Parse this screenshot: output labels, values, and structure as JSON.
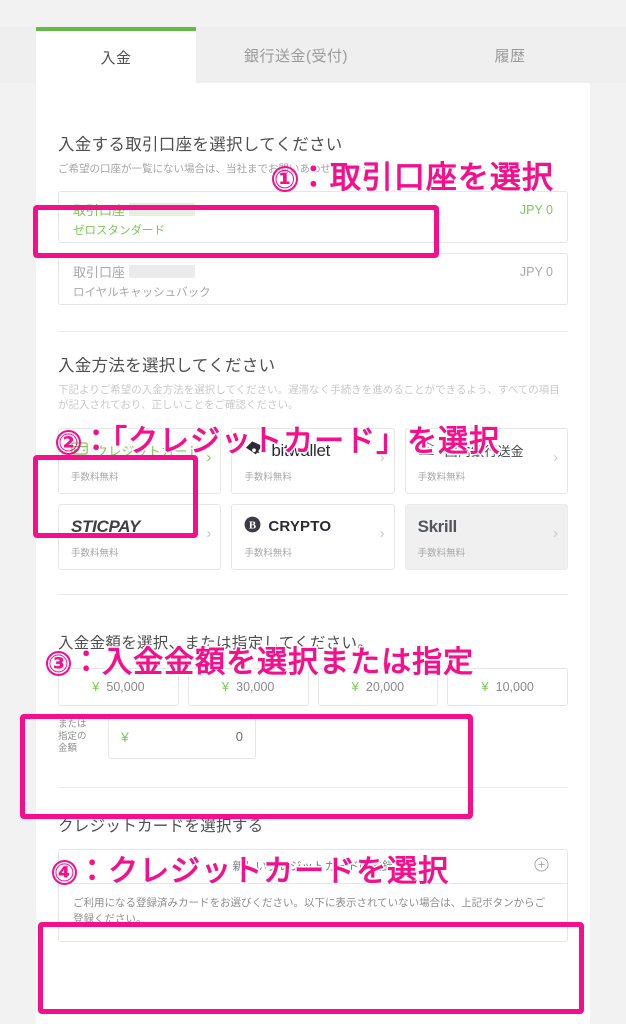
{
  "tabs": [
    {
      "label": "入金",
      "active": true
    },
    {
      "label": "銀行送金(受付)",
      "active": false
    },
    {
      "label": "履歴",
      "active": false
    }
  ],
  "account_section": {
    "title": "入金する取引口座を選択してください",
    "subtitle": "ご希望の口座が一覧にない場合は、当社までお問いあわせください。",
    "accounts": [
      {
        "label": "取引口座",
        "type": "ゼロスタンダード",
        "amount": "JPY 0",
        "selected": true
      },
      {
        "label": "取引口座",
        "type": "ロイヤルキャッシュバック",
        "amount": "JPY 0",
        "selected": false
      }
    ]
  },
  "method_section": {
    "title": "入金方法を選択してください",
    "subtitle": "下記よりご希望の入金方法を選択してください。遅滞なく手続きを進めることができるよう、すべての項目が記入されており、正しいことをご確認ください。",
    "methods": [
      {
        "name": "クレジットカード",
        "fee": "手数料無料",
        "icon": "credit-card-icon",
        "selected": true,
        "grey": false
      },
      {
        "name": "bitwallet",
        "fee": "手数料無料",
        "icon": "bitwallet-logo",
        "selected": false,
        "grey": false
      },
      {
        "name": "国内銀行送金",
        "fee": "手数料無料",
        "icon": "bank-icon",
        "selected": false,
        "grey": false
      },
      {
        "name": "STICPAY",
        "fee": "手数料無料",
        "icon": "sticpay-logo",
        "selected": false,
        "grey": false
      },
      {
        "name": "CRYPTO",
        "fee": "手数料無料",
        "icon": "bitcoin-icon",
        "selected": false,
        "grey": false
      },
      {
        "name": "Skrill",
        "fee": "手数料無料",
        "icon": "skrill-logo",
        "selected": false,
        "grey": true
      }
    ]
  },
  "amount_section": {
    "title": "入金金額を選択、または指定してください。",
    "presets": [
      {
        "yen": "¥",
        "value": "50,000"
      },
      {
        "yen": "¥",
        "value": "30,000"
      },
      {
        "yen": "¥",
        "value": "20,000"
      },
      {
        "yen": "¥",
        "value": "10,000"
      }
    ],
    "custom_label": "または\n指定の\n金額",
    "custom_label_lines": [
      "または",
      "指定の",
      "金額"
    ],
    "custom_yen": "¥",
    "custom_value": "0"
  },
  "card_section": {
    "title": "クレジットカードを選択する",
    "register_label": "新しいクレジットカードの登録",
    "plus_icon": "plus-circle-icon",
    "note": "ご利用になる登録済みカードをお選びください。以下に表示されていない場合は、上記ボタンからご登録ください。"
  },
  "annotations": [
    {
      "num": "①",
      "text": "：取引口座を選択"
    },
    {
      "num": "②",
      "text": "：「クレジットカード」を選択"
    },
    {
      "num": "③",
      "text": "：入金金額を選択または指定"
    },
    {
      "num": "④",
      "text": "：クレジットカードを選択"
    }
  ],
  "colors": {
    "accent_green": "#63bb46",
    "annotation_pink": "#f50f8c",
    "page_bg": "#f2f2f2"
  }
}
